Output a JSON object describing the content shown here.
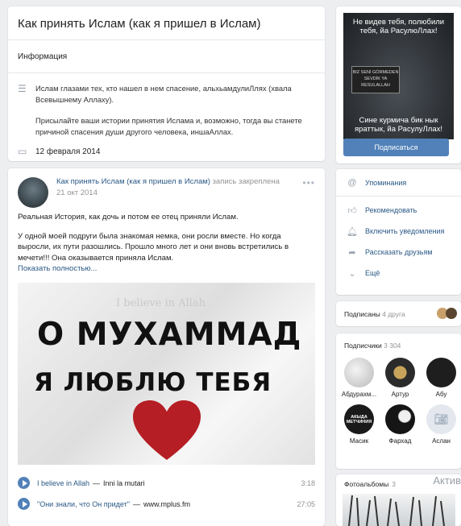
{
  "community": {
    "title": "Как принять Ислам (как я пришел в Ислам)",
    "tab_info": "Информация",
    "description_p1": "Ислам глазами тех, кто нашел в нем спасение, альхьамдулиЛлях (хвала Всевышнему Аллаху).",
    "description_p2": "Присылайте ваши истории принятия Ислама и, возможно, тогда вы станете причиной спасения души другого человека, иншаАллах.",
    "date": "12 февраля 2014"
  },
  "post": {
    "author": "Как принять Ислам (как я пришел в Ислам)",
    "pinned": "запись закреплена",
    "date": "21 окт 2014",
    "text_p1": "Реальная История, как дочь и потом ее отец приняли Ислам.",
    "text_p2": "У одной моей подруги была знакомая немка, они росли вместе. Но когда выросли, их пути разошлись. Прошло много лет и они вновь встретились в мечети!!! Она оказывается приняла Ислам.",
    "more": "Показать полностью...",
    "image_faint": "I believe in Allah",
    "image_line1": "О МУХАММАД",
    "image_line2": "Я ЛЮБЛЮ ТЕБЯ",
    "tracks": [
      {
        "artist": "I believe in Allah",
        "title": "Inni la mutari",
        "duration": "3:18"
      },
      {
        "artist": "\"Они знали, что Он придет\"",
        "title": "www.mplus.fm",
        "duration": "27:05"
      }
    ]
  },
  "cover": {
    "caption_top": "Не видев тебя, полюбили тебя, йа РасулюЛлах!",
    "banner": "BIZ SENİ GÖRMEDEN SEVDİK YA RESULALLAH",
    "caption_bottom": "Сине курмича бик нык яраттык, йа РасулуЛлах!",
    "subscribe_button": "Подписаться"
  },
  "actions": {
    "mentions": "Упоминания",
    "recommend": "Рекомендовать",
    "notifications": "Включить уведомления",
    "share": "Рассказать друзьям",
    "more": "Ещё"
  },
  "friends": {
    "label": "Подписаны",
    "count": "4 друга"
  },
  "subscribers": {
    "label": "Подписчики",
    "count": "3 304",
    "items": [
      {
        "name": "Абдурахм...",
        "inner": ""
      },
      {
        "name": "Артур",
        "inner": ""
      },
      {
        "name": "Абу",
        "inner": ""
      },
      {
        "name": "Масик",
        "inner": "АКЫДА МЕТЧИНИЯ"
      },
      {
        "name": "Фархад",
        "inner": ""
      },
      {
        "name": "Аслан",
        "inner": ""
      }
    ]
  },
  "albums": {
    "label": "Фотоальбомы",
    "count": "3",
    "watermark": "Актив"
  },
  "colors": {
    "accent": "#5181b8",
    "link": "#2a5885",
    "background": "#edeef0",
    "heart": "#b51e24"
  }
}
